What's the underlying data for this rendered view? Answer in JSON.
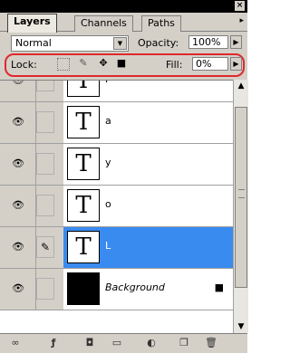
{
  "window": {
    "close_glyph": "×"
  },
  "tabs": [
    {
      "label": "Layers"
    },
    {
      "label": "Channels"
    },
    {
      "label": "Paths"
    }
  ],
  "tab_menu_glyph": "▸",
  "blend_mode": {
    "value": "Normal"
  },
  "opacity": {
    "label": "Opacity:",
    "value": "100%"
  },
  "lock": {
    "label": "Lock:",
    "icons": [
      "transparency-lock-icon",
      "brush-lock-icon",
      "move-lock-icon",
      "padlock-icon"
    ]
  },
  "fill": {
    "label": "Fill:",
    "value": "0%"
  },
  "layers": [
    {
      "name": "I",
      "type": "text",
      "thumb": "T"
    },
    {
      "name": "a",
      "type": "text",
      "thumb": "T"
    },
    {
      "name": "y",
      "type": "text",
      "thumb": "T"
    },
    {
      "name": "o",
      "type": "text",
      "thumb": "T"
    },
    {
      "name": "L",
      "type": "text",
      "thumb": "T",
      "selected": true
    },
    {
      "name": "Background",
      "type": "image"
    }
  ],
  "colors": {
    "selection": "#3a8bf0",
    "highlight_ring": "#e0282c",
    "panel": "#d4d0c8"
  },
  "bottom_icons": [
    "link-layers-icon",
    "layer-style-icon",
    "mask-icon",
    "new-group-icon",
    "adjustment-layer-icon",
    "new-layer-icon",
    "trash-icon"
  ]
}
